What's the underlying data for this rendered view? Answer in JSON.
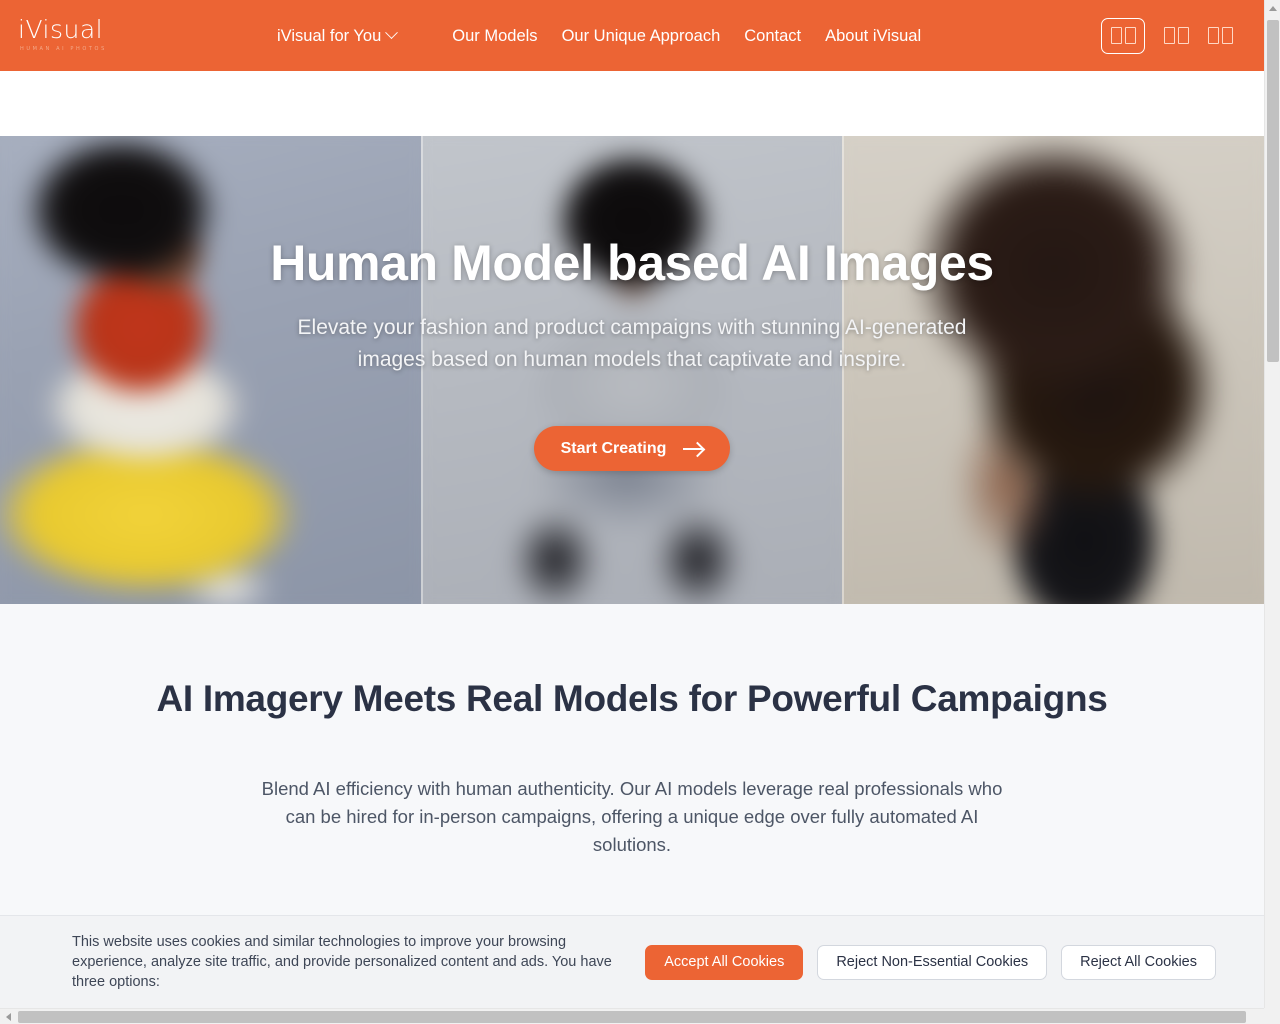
{
  "brand": {
    "name": "iVisual",
    "tagline": "HUMAN AI PHOTOS"
  },
  "nav": {
    "items": [
      {
        "label": "iVisual for You",
        "has_caret": true
      },
      {
        "label": "Our Models",
        "has_caret": false
      },
      {
        "label": "Our Unique Approach",
        "has_caret": false
      },
      {
        "label": "Contact",
        "has_caret": false
      },
      {
        "label": "About iVisual",
        "has_caret": false
      }
    ]
  },
  "header_actions": {
    "items": [
      {
        "label": "□□",
        "style": "outlined",
        "icon": "missing-glyph"
      },
      {
        "label": "□□",
        "style": "plain",
        "icon": "missing-glyph"
      },
      {
        "label": "□□",
        "style": "plain",
        "icon": "missing-glyph"
      }
    ]
  },
  "hero": {
    "title": "Human Model based AI Images",
    "subtitle": "Elevate your fashion and product campaigns with stunning AI-generated images based on human models that captivate and inspire.",
    "cta_label": "Start Creating",
    "cta_icon": "arrow-right-icon",
    "panels": [
      {
        "alt": "Model in red blouse and yellow trousers seated",
        "bg": "#9aa3b4"
      },
      {
        "alt": "Model in grey sweatsuit seated on floor",
        "bg": "#b8bcc4"
      },
      {
        "alt": "Model with curly hair in black top",
        "bg": "#cdc6bc"
      }
    ]
  },
  "intro": {
    "title": "AI Imagery Meets Real Models for Powerful Campaigns",
    "body": "Blend AI efficiency with human authenticity. Our AI models leverage real professionals who can be hired for in-person campaigns, offering a unique edge over fully automated AI solutions."
  },
  "cookie_banner": {
    "text": "This website uses cookies and similar technologies to improve your browsing experience, analyze site traffic, and provide personalized content and ads. You have three options:",
    "accept_label": "Accept All Cookies",
    "reject_non_essential_label": "Reject Non-Essential Cookies",
    "reject_all_label": "Reject All Cookies"
  },
  "colors": {
    "brand_orange": "#ec6434",
    "heading_navy": "#2b3245",
    "section_bg": "#f7f8fa",
    "cookie_bg": "#f2f3f5"
  }
}
